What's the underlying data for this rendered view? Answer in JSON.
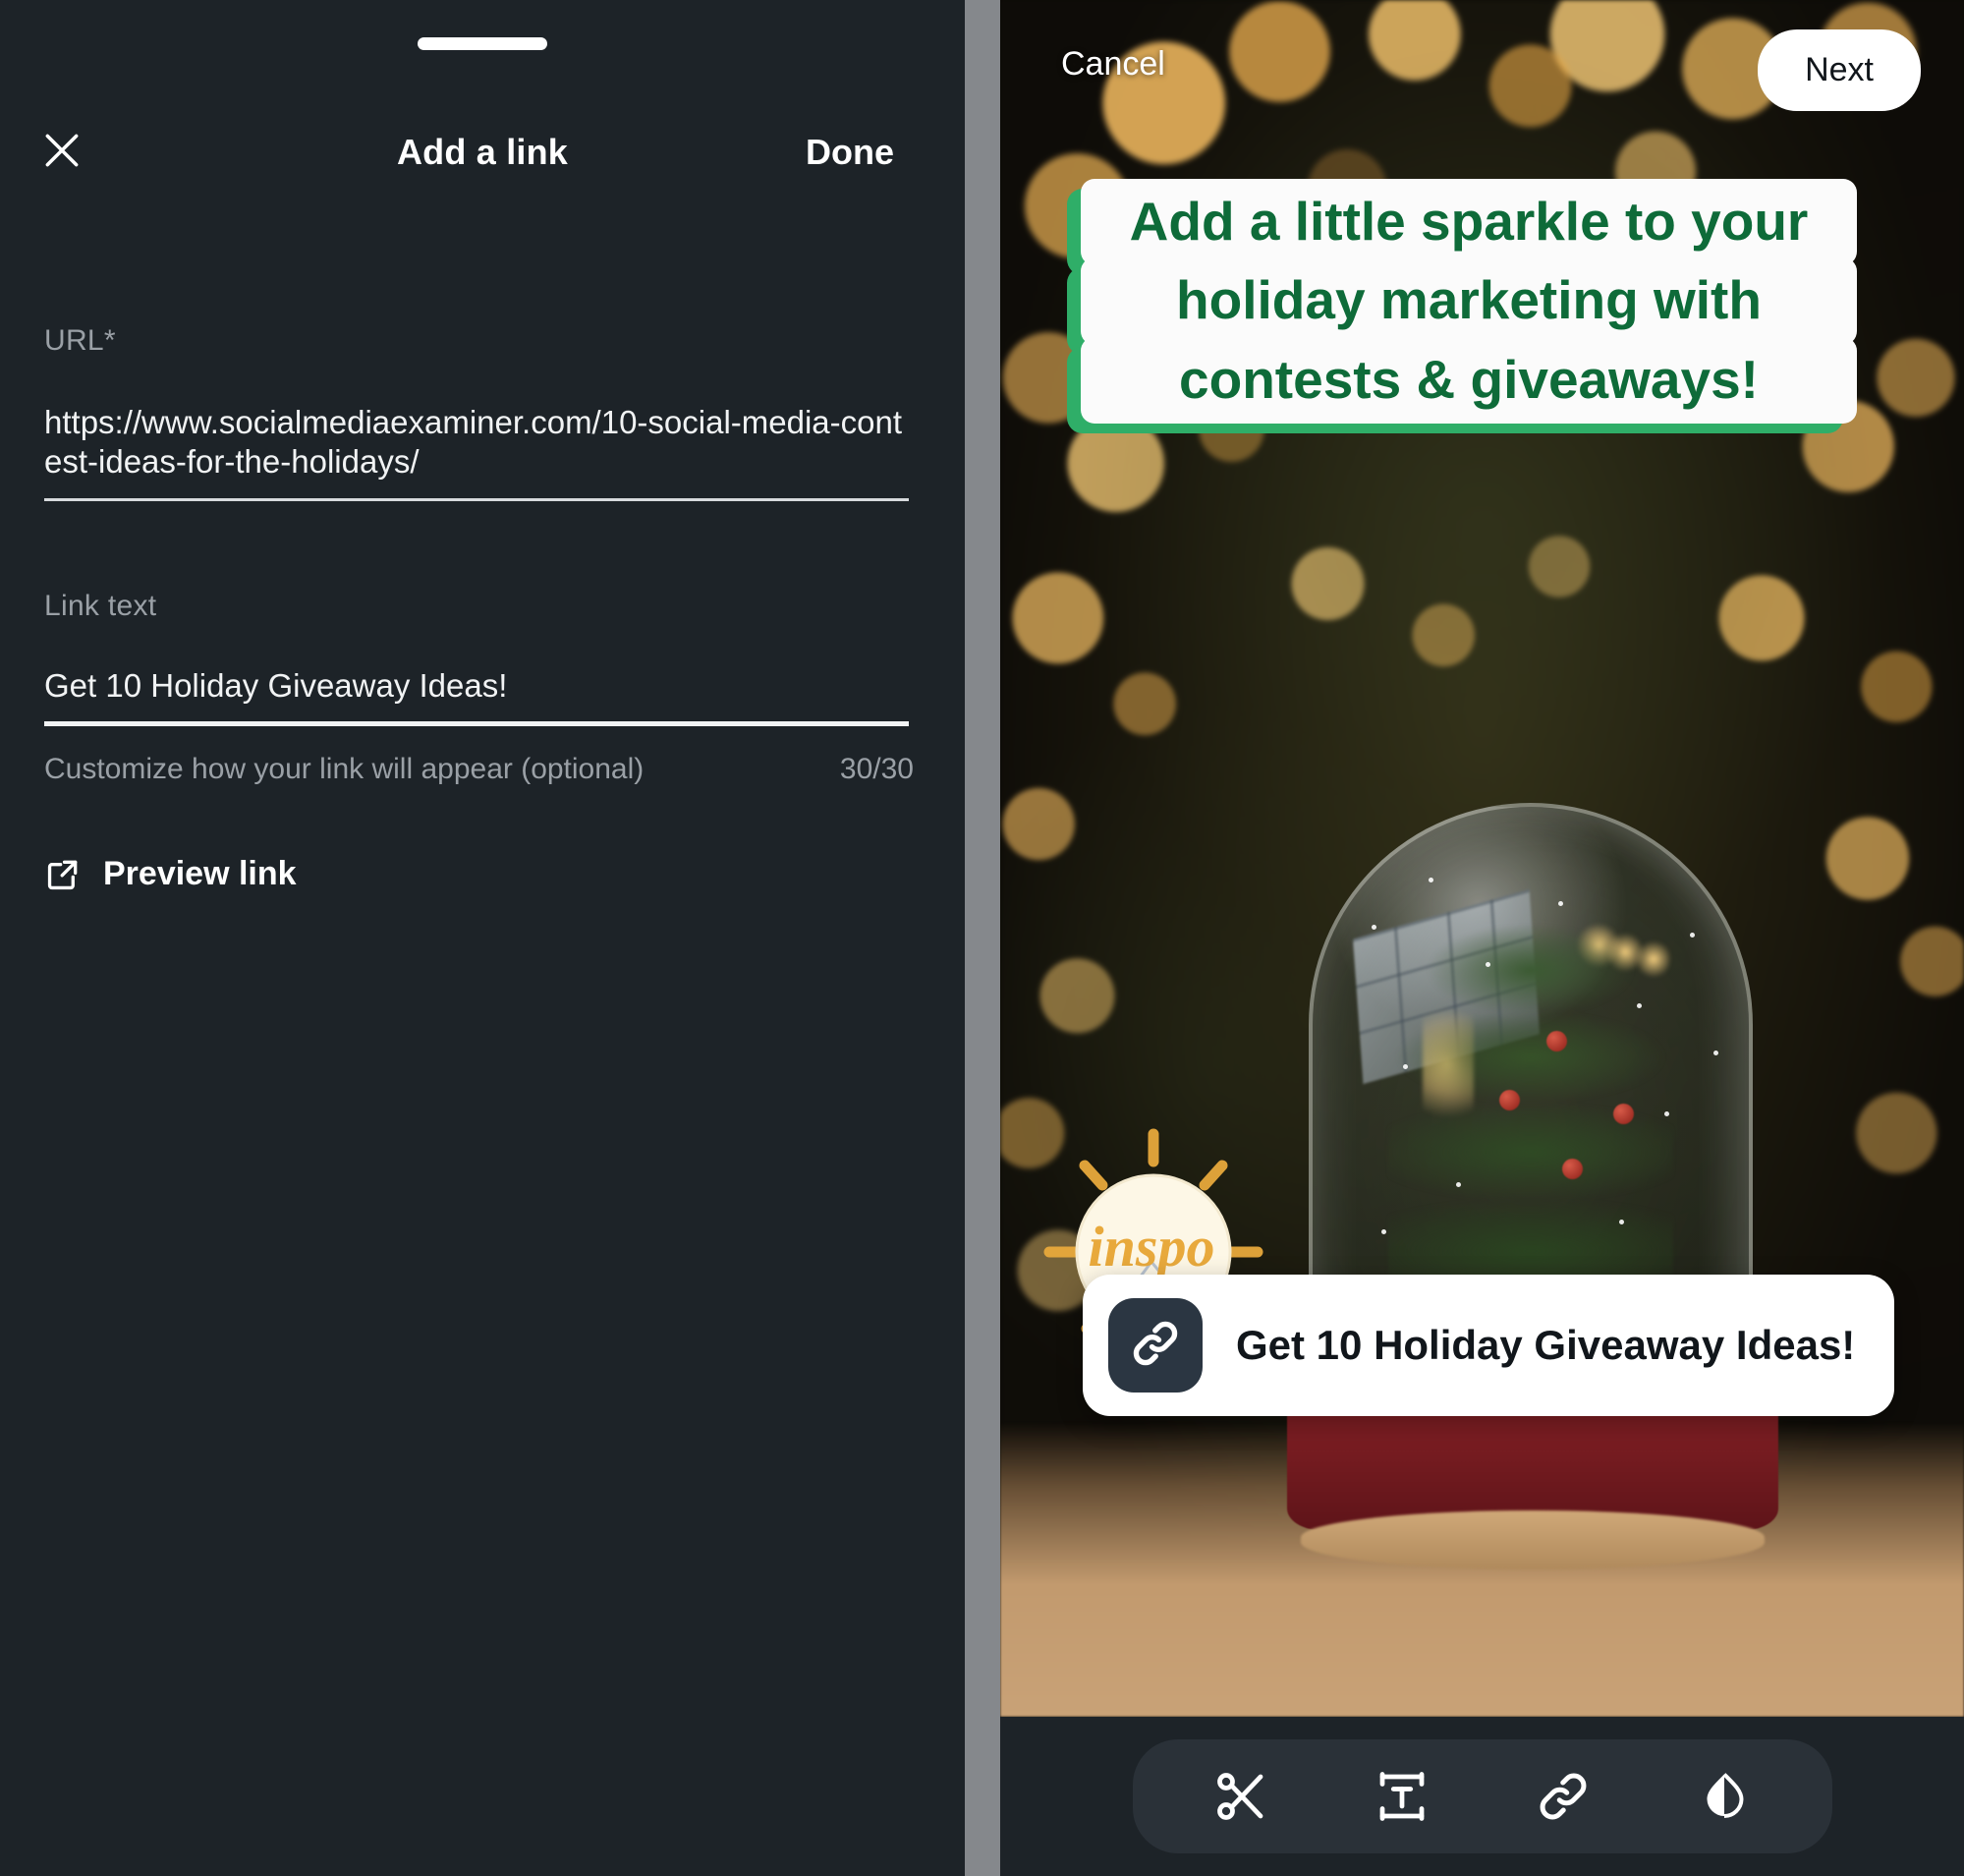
{
  "left_sheet": {
    "title": "Add a link",
    "close_icon": "close-x-icon",
    "done_label": "Done",
    "drag_handle": "sheet-drag-handle",
    "url_field": {
      "label": "URL*",
      "value": "https://www.socialmediaexaminer.com/10-social-media-contest-ideas-for-the-holidays/",
      "placeholder": "URL"
    },
    "link_text_field": {
      "label": "Link text",
      "value": "Get 10 Holiday Giveaway Ideas!",
      "placeholder": "Link text",
      "helper": "Customize how your link will appear (optional)",
      "counter": "30/30"
    },
    "preview_link": {
      "label": "Preview link",
      "icon": "external-link-icon"
    }
  },
  "story_editor": {
    "cancel_label": "Cancel",
    "next_label": "Next",
    "caption": {
      "lines": [
        "Add a little sparkle to your",
        "holiday marketing with",
        "contests & giveaways!"
      ],
      "text_color": "#0e6b39",
      "box_color": "#fbfbfb",
      "shadow_color": "#2fae68"
    },
    "inspo_sticker": {
      "label": "inspo",
      "icon": "lightbulb-icon",
      "glow_color": "#e8a93c"
    },
    "link_sticker": {
      "label": "Get 10 Holiday Giveaway Ideas!",
      "icon": "link-chain-icon",
      "chip_color": "#2b3642"
    },
    "toolbar": {
      "items": [
        {
          "name": "trim-tool",
          "icon": "scissors-icon"
        },
        {
          "name": "text-tool",
          "icon": "text-box-icon"
        },
        {
          "name": "link-tool",
          "icon": "link-chain-icon"
        },
        {
          "name": "filter-tool",
          "icon": "droplet-icon"
        }
      ]
    }
  },
  "theme": {
    "sheet_background": "#1d2328",
    "divider": "#85888c",
    "accent_white": "#ffffff",
    "muted_text": "#9aa0a6"
  }
}
